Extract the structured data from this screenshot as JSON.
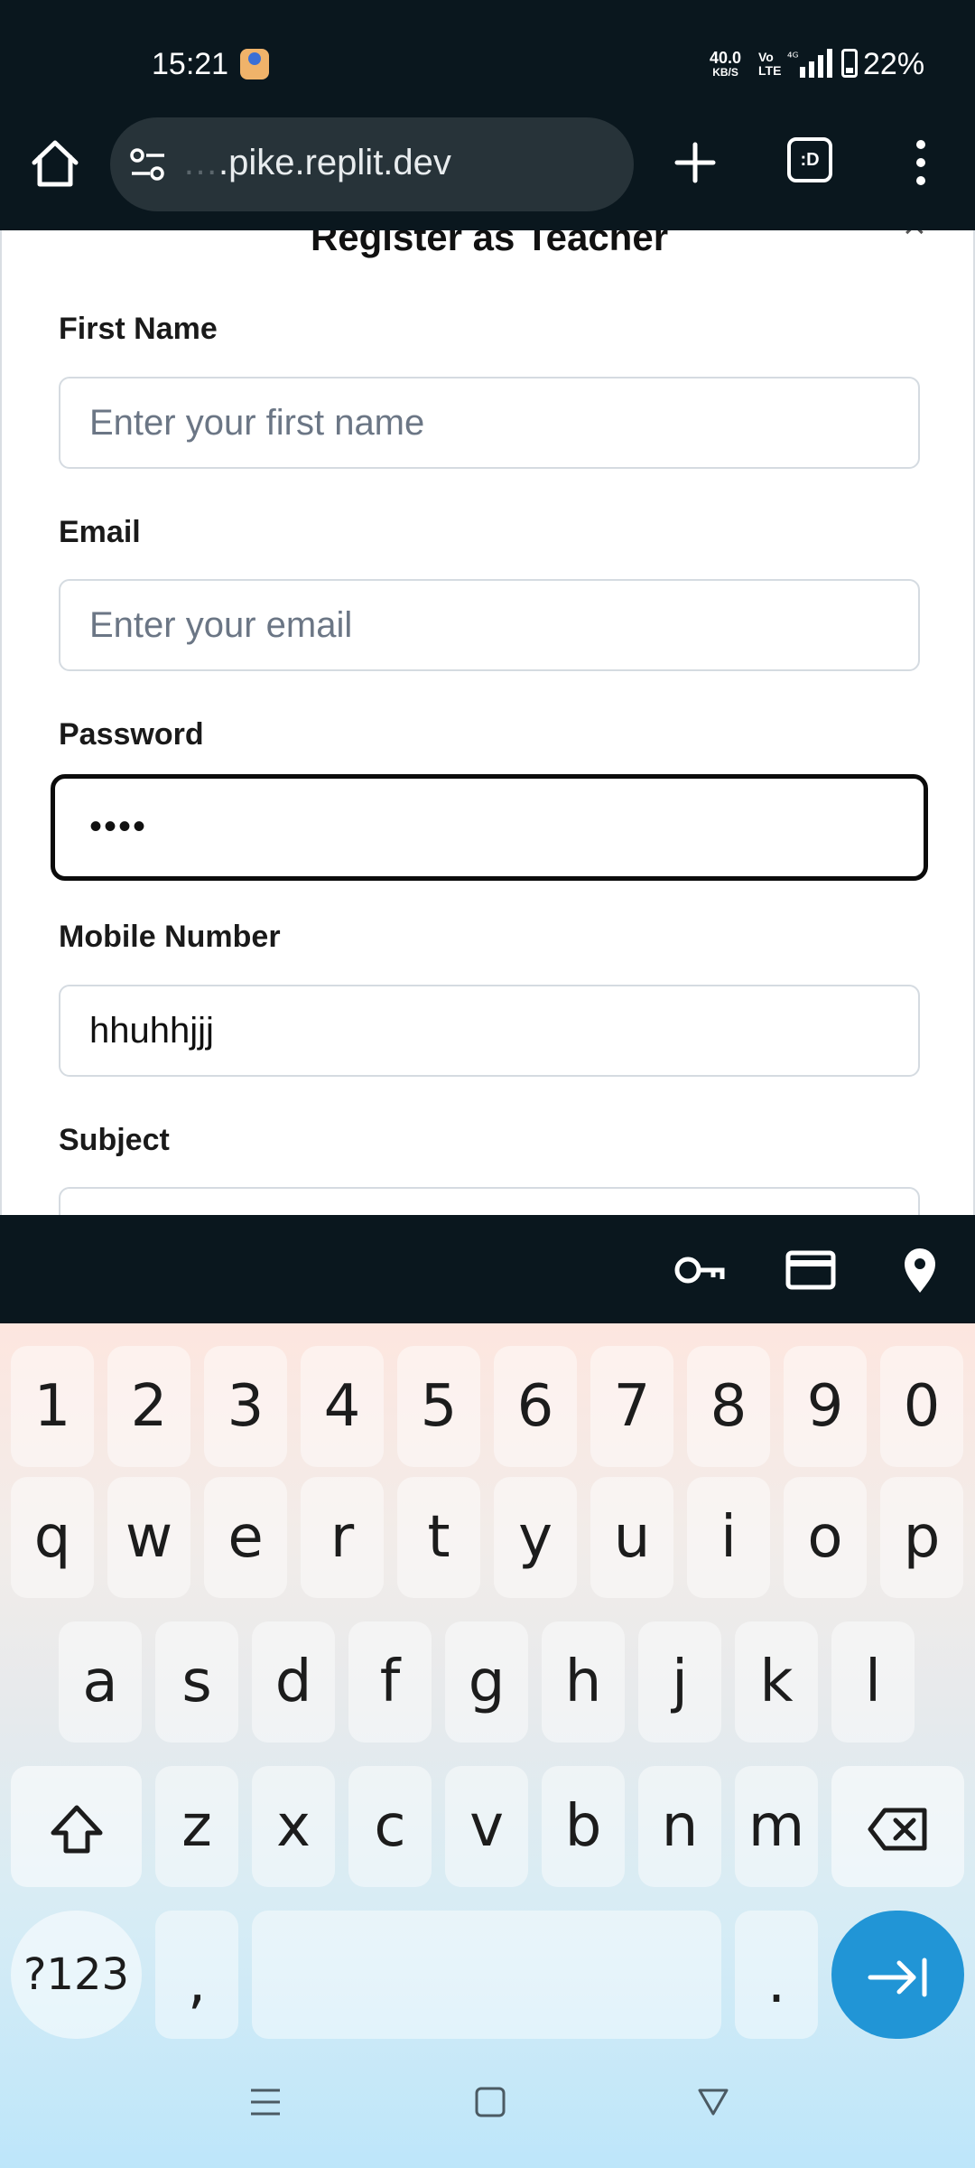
{
  "status_bar": {
    "time": "15:21",
    "net_speed": "40.0",
    "net_speed_unit": "KB/S",
    "volte": "Vo",
    "volte_sub": "LTE",
    "battery": "22%"
  },
  "browser": {
    "url_faded": "…",
    "url": ".pike.replit.dev",
    "tabs_label": ":D"
  },
  "form": {
    "title": "Register as Teacher",
    "close": "×",
    "fields": [
      {
        "label": "First Name",
        "placeholder": "Enter your first name",
        "value": ""
      },
      {
        "label": "Email",
        "placeholder": "Enter your email",
        "value": ""
      },
      {
        "label": "Password",
        "placeholder": "",
        "value": "••••"
      },
      {
        "label": "Mobile Number",
        "placeholder": "",
        "value": "hhuhhjjj"
      },
      {
        "label": "Subject",
        "placeholder": "",
        "value": ""
      }
    ]
  },
  "autofill": {
    "icons": [
      "key-icon",
      "credit-card-icon",
      "location-pin-icon"
    ]
  },
  "keyboard": {
    "row_numbers": [
      "1",
      "2",
      "3",
      "4",
      "5",
      "6",
      "7",
      "8",
      "9",
      "0"
    ],
    "row_top": [
      "q",
      "w",
      "e",
      "r",
      "t",
      "y",
      "u",
      "i",
      "o",
      "p"
    ],
    "row_middle": [
      "a",
      "s",
      "d",
      "f",
      "g",
      "h",
      "j",
      "k",
      "l"
    ],
    "row_bottom": [
      "z",
      "x",
      "c",
      "v",
      "b",
      "n",
      "m"
    ],
    "symbols_key": "?123",
    "comma_key": ",",
    "period_key": "."
  },
  "colors": {
    "system_bar": "#0a171e",
    "url_pill": "#273339",
    "enter_key": "#2195d6"
  }
}
